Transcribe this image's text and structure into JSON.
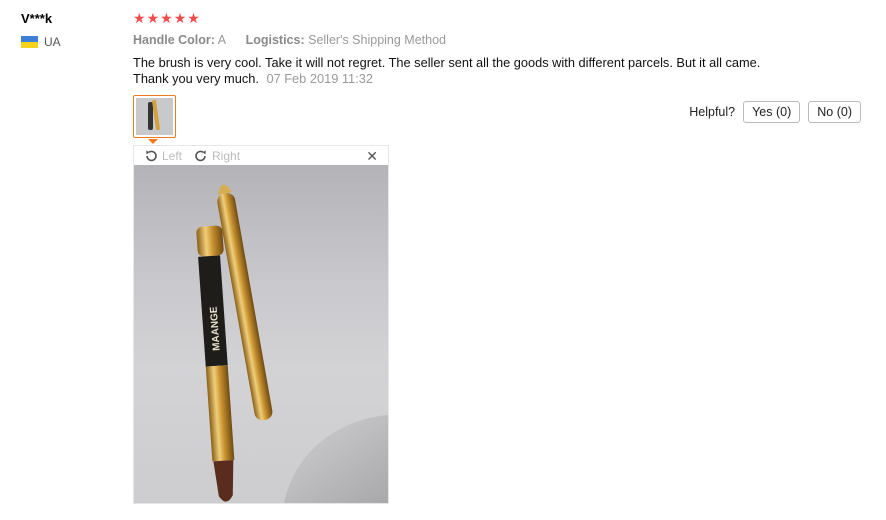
{
  "review": {
    "user_name": "V***k",
    "country_code": "UA",
    "rating": 5,
    "attributes": [
      {
        "label": "Handle Color:",
        "value": "A"
      },
      {
        "label": "Logistics:",
        "value": "Seller's Shipping Method"
      }
    ],
    "text": "The brush is very cool. Take it will not regret. The seller sent all the goods with different parcels. But it all came. Thank you very much.",
    "date": "07 Feb 2019 11:32"
  },
  "helpful": {
    "label": "Helpful?",
    "yes_label": "Yes (0)",
    "no_label": "No (0)"
  },
  "viewer": {
    "rotate_left_label": "Left",
    "rotate_right_label": "Right",
    "close_glyph": "✕",
    "brush_brand": "MAANGE"
  },
  "colors": {
    "star": "#f24b4b",
    "thumb_border": "#f07a1c",
    "gold": "#d1a23d"
  }
}
